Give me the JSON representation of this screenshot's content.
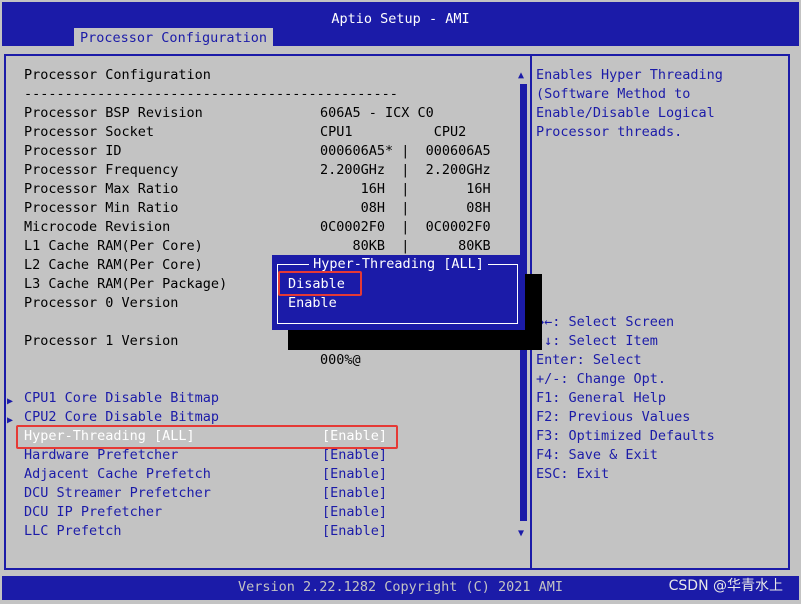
{
  "header": {
    "title": "Aptio Setup - AMI",
    "tab": "Processor Configuration"
  },
  "footer": {
    "version": "Version 2.22.1282 Copyright (C) 2021 AMI",
    "watermark": "CSDN @华青水上"
  },
  "main": {
    "heading": "Processor Configuration",
    "separator": "----------------------------------------------",
    "info": [
      {
        "label": "Processor BSP Revision",
        "value": "606A5 - ICX C0"
      },
      {
        "label": "Processor Socket",
        "value": "CPU1          CPU2"
      },
      {
        "label": "Processor ID",
        "value": "000606A5* |  000606A5"
      },
      {
        "label": "Processor Frequency",
        "value": "2.200GHz  |  2.200GHz"
      },
      {
        "label": "Processor Max Ratio",
        "value": "     16H  |       16H"
      },
      {
        "label": "Processor Min Ratio",
        "value": "     08H  |       08H"
      },
      {
        "label": "Microcode Revision",
        "value": "0C0002F0  |  0C0002F0"
      },
      {
        "label": "L1 Cache RAM(Per Core)",
        "value": "    80KB  |      80KB"
      },
      {
        "label": "L2 Cache RAM(Per Core)",
        "value": ""
      },
      {
        "label": "L3 Cache RAM(Per Package)",
        "value": ""
      },
      {
        "label": "Processor 0 Version",
        "value": ""
      },
      {
        "label": "Processor 1 Version",
        "value": ""
      },
      {
        "label": "",
        "value": "000%@"
      }
    ],
    "submenus": [
      "CPU1 Core Disable Bitmap",
      "CPU2 Core Disable Bitmap"
    ],
    "settings": [
      {
        "label": "Hyper-Threading [ALL]",
        "value": "[Enable]"
      },
      {
        "label": "Hardware Prefetcher",
        "value": "[Enable]"
      },
      {
        "label": "Adjacent Cache Prefetch",
        "value": "[Enable]"
      },
      {
        "label": "DCU Streamer Prefetcher",
        "value": "[Enable]"
      },
      {
        "label": "DCU IP Prefetcher",
        "value": "[Enable]"
      },
      {
        "label": "LLC Prefetch",
        "value": "[Enable]"
      }
    ]
  },
  "help": {
    "lines": [
      "Enables Hyper Threading",
      "(Software Method to",
      "Enable/Disable Logical",
      "Processor threads."
    ],
    "keys": [
      "→←: Select Screen",
      "↑↓: Select Item",
      "Enter: Select",
      "+/-: Change Opt.",
      "F1: General Help",
      "F2: Previous Values",
      "F3: Optimized Defaults",
      "F4: Save & Exit",
      "ESC: Exit"
    ]
  },
  "popup": {
    "title": "Hyper-Threading [ALL]",
    "options": [
      "Disable",
      "Enable"
    ]
  },
  "colors": {
    "bios_blue": "#1b1ba8",
    "bios_gray": "#c3c3c3",
    "highlight_red": "#e53935"
  }
}
